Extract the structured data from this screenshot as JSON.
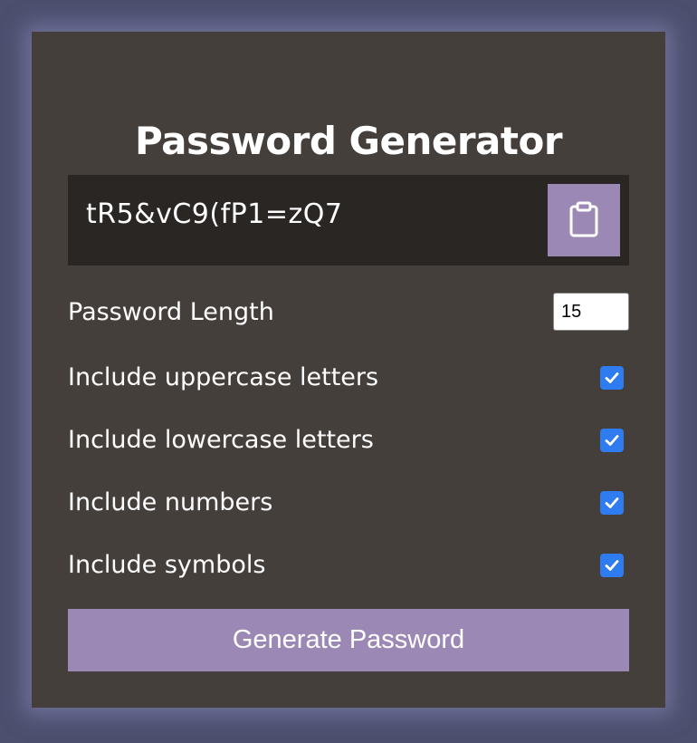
{
  "app": {
    "title": "Password Generator"
  },
  "result": {
    "password": "tR5&vC9(fP1=zQ7",
    "copy_icon": "clipboard-icon"
  },
  "settings": {
    "length_label": "Password Length",
    "length_value": "15",
    "options": [
      {
        "label": "Include uppercase letters",
        "checked": true
      },
      {
        "label": "Include lowercase letters",
        "checked": true
      },
      {
        "label": "Include numbers",
        "checked": true
      },
      {
        "label": "Include symbols",
        "checked": true
      }
    ]
  },
  "actions": {
    "generate_label": "Generate Password"
  },
  "colors": {
    "page_background": "#4d4f6f",
    "card_background": "#453f3c",
    "result_background": "#2a2624",
    "accent": "#9c88b4",
    "checkbox": "#2f7bf0"
  }
}
